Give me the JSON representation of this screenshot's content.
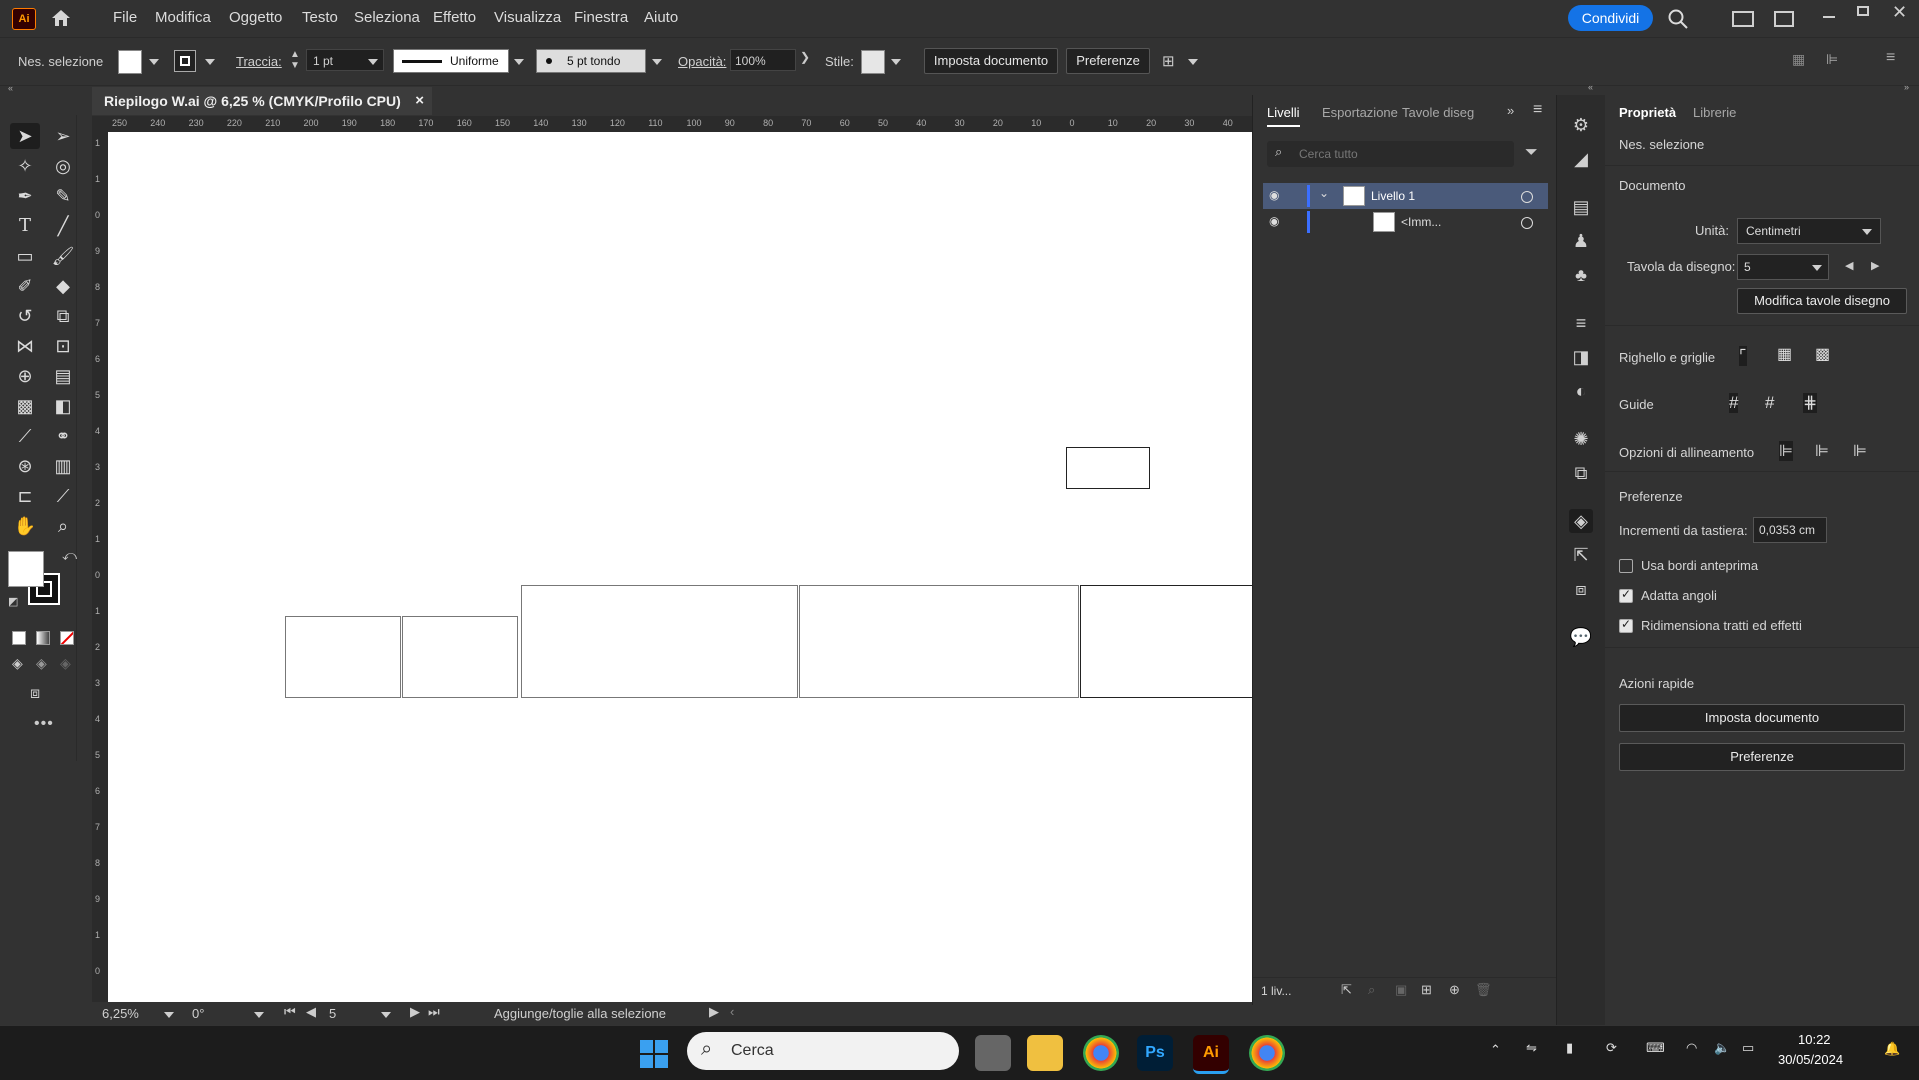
{
  "app": {
    "logo": "Ai",
    "home_icon": "home-icon"
  },
  "menu": [
    "File",
    "Modifica",
    "Oggetto",
    "Testo",
    "Seleziona",
    "Effetto",
    "Visualizza",
    "Finestra",
    "Aiuto"
  ],
  "share_label": "Condividi",
  "control": {
    "no_selection": "Nes. selezione",
    "stroke_label": "Traccia:",
    "stroke_value": "1 pt",
    "profile_value": "Uniforme",
    "brush_value": "5 pt tondo",
    "opacity_label": "Opacità:",
    "opacity_value": "100%",
    "style_label": "Stile:",
    "doc_setup": "Imposta documento",
    "prefs": "Preferenze"
  },
  "document": {
    "tab_title": "Riepilogo W.ai @ 6,25 % (CMYK/Profilo CPU)",
    "close": "×"
  },
  "ruler_h": [
    "250",
    "240",
    "230",
    "220",
    "210",
    "200",
    "190",
    "180",
    "170",
    "160",
    "150",
    "140",
    "130",
    "120",
    "110",
    "100",
    "90",
    "80",
    "70",
    "60",
    "50",
    "40",
    "30",
    "20",
    "10",
    "0",
    "10",
    "20",
    "30",
    "40"
  ],
  "ruler_v": [
    "1",
    "1",
    "0",
    "9",
    "8",
    "7",
    "6",
    "5",
    "4",
    "3",
    "2",
    "1",
    "0",
    "1",
    "2",
    "3",
    "4",
    "5",
    "6",
    "7",
    "8",
    "9",
    "1",
    "0"
  ],
  "status": {
    "zoom": "6,25%",
    "rotation": "0°",
    "artboard": "5",
    "message": "Aggiunge/toglie alla selezione"
  },
  "layers": {
    "tabs": [
      "Livelli",
      "Esportazione",
      "Tavole diseg"
    ],
    "search_placeholder": "Cerca tutto",
    "rows": [
      {
        "name": "Livello 1"
      },
      {
        "name": "<Imm..."
      }
    ],
    "footer_count": "1 liv..."
  },
  "properties": {
    "tabs": [
      "Proprietà",
      "Librerie"
    ],
    "no_selection": "Nes. selezione",
    "document_header": "Documento",
    "units_label": "Unità:",
    "units_value": "Centimetri",
    "artboard_label": "Tavola da disegno:",
    "artboard_value": "5",
    "edit_artboards": "Modifica tavole disegno",
    "rulers_grids": "Righello e griglie",
    "guides": "Guide",
    "align_options": "Opzioni di allineamento",
    "prefs_header": "Preferenze",
    "keyboard_inc_label": "Incrementi da tastiera:",
    "keyboard_inc_value": "0,0353 cm",
    "checkboxes": [
      {
        "label": "Usa bordi anteprima",
        "checked": false
      },
      {
        "label": "Adatta angoli",
        "checked": true
      },
      {
        "label": "Ridimensiona tratti ed effetti",
        "checked": true
      }
    ],
    "quick_actions": "Azioni rapide",
    "qa_doc_setup": "Imposta documento",
    "qa_prefs": "Preferenze"
  },
  "taskbar": {
    "search_label": "Cerca",
    "time": "10:22",
    "date": "30/05/2024",
    "apps": [
      "Ps",
      "Ai"
    ]
  },
  "colors": {
    "accent": "#1473e6",
    "layer_highlight": "#4a5a7a",
    "canvas": "#ffffff"
  }
}
